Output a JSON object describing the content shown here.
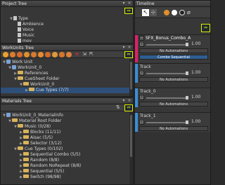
{
  "project_tree": {
    "title": "Project Tree",
    "items": [
      "Type",
      "Ambience",
      "Voice",
      "Music",
      "mov"
    ]
  },
  "workunits_tree": {
    "title": "WorkUnits Tree",
    "items": [
      "Work Unit",
      "WorkUnit_0",
      "References",
      "CueSheet Folder",
      "WorkUnit_0",
      "Cue Types (7/7)"
    ]
  },
  "materials_tree": {
    "title": "Materials Tree",
    "items": [
      "WorkUnit_0_MaterialInfo",
      "Material Root Folder",
      "Music (0/28)",
      "Blocks (11/11)",
      "Aisac (5/5)",
      "Selector (3/12)",
      "Cue Types (0/102)",
      "Sequential Combo (5/5)",
      "Random (8/8)",
      "Random NoRepeat (8/8)",
      "Sequential (5/5)",
      "Switch (98/98)"
    ]
  },
  "timeline": {
    "title": "Timeline",
    "cue_name": "SFX_Bonus_Combo_A",
    "cue_value": "1.00",
    "cue_automation": "No Automations",
    "cue_type": "Combo Sequential",
    "tracks": [
      {
        "name": "Track",
        "value": "1.00",
        "automation": "No Automations"
      },
      {
        "name": "Track_0",
        "value": "1.00",
        "automation": "No Automations"
      },
      {
        "name": "Track_1",
        "value": "1.00",
        "automation": "No Automations"
      }
    ]
  },
  "colors": {
    "highlight": "#e8f000",
    "selection": "#2d4f7a",
    "cue_stripe": "#e0206a",
    "track_stripe": "#3a8fd8"
  }
}
